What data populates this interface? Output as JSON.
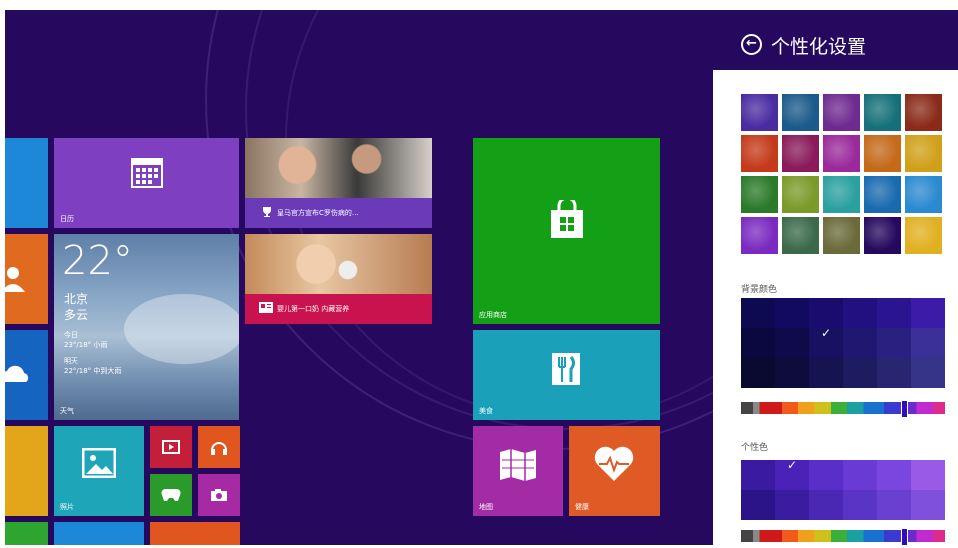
{
  "panel": {
    "title": "个性化设置",
    "back_icon": "back-arrow-circle-icon",
    "background_color_label": "背景颜色",
    "accent_color_label": "个性色"
  },
  "tiles": {
    "calendar_label": "日历",
    "weather": {
      "temp": "22°",
      "city": "北京",
      "condition": "多云",
      "today_label": "今日",
      "today_forecast": "23°/18° 小雨",
      "tomorrow_label": "明天",
      "tomorrow_forecast": "22°/18° 中到大雨",
      "label": "天气"
    },
    "news1_caption": "皇马官方宣布C罗伤病的…",
    "news2_caption": "婴儿第一口奶 内藏营养",
    "store_label": "应用商店",
    "food_label": "美食",
    "photos_label": "照片",
    "maps_label": "地图",
    "health_label": "健康"
  },
  "colors": {
    "start_bg": "#26095e",
    "accent_selected": "#5b2fc0"
  }
}
